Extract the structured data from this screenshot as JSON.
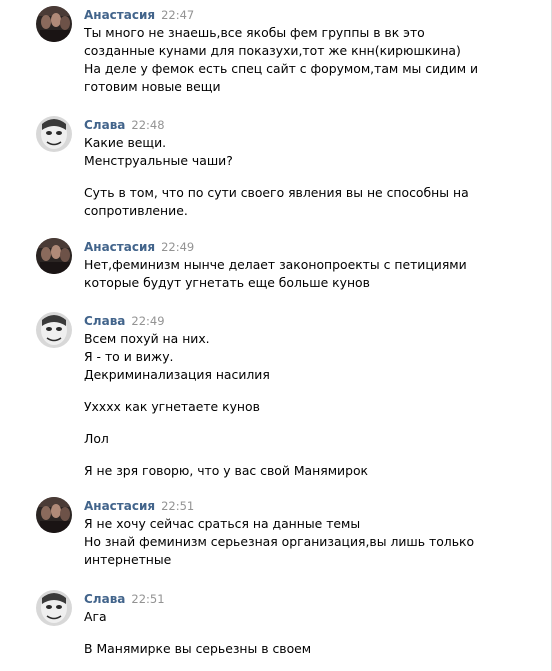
{
  "messages": [
    {
      "author": "Анастасия",
      "time": "22:47",
      "avatar": "anastasia-avatar",
      "lines": [
        "Ты много не знаешь,все якобы фем группы в вк это",
        "созданные кунами для показухи,тот же кнн(кирюшкина)",
        "На деле у фемок есть спец сайт с форумом,там мы сидим и",
        "готовим новые вещи"
      ]
    },
    {
      "author": "Слава",
      "time": "22:48",
      "avatar": "slava-avatar",
      "lines": [
        "Какие вещи.",
        "Менструальные чаши?",
        "",
        "Суть в том, что по сути своего явления вы не способны на",
        "сопротивление."
      ]
    },
    {
      "author": "Анастасия",
      "time": "22:49",
      "avatar": "anastasia-avatar",
      "lines": [
        "Нет,феминизм нынче делает законопроекты с петициями",
        "которые будут угнетать еще больше кунов"
      ]
    },
    {
      "author": "Слава",
      "time": "22:49",
      "avatar": "slava-avatar",
      "lines": [
        "Всем похуй на них.",
        "Я - то и вижу.",
        "Декриминализация насилия",
        "",
        "Ухххх как угнетаете кунов",
        "",
        "Лол",
        "",
        "Я не зря говорю, что у вас свой Манямирок"
      ]
    },
    {
      "author": "Анастасия",
      "time": "22:51",
      "avatar": "anastasia-avatar",
      "lines": [
        "Я не хочу сейчас сраться на данные темы",
        "Но знай феминизм серьезная организация,вы лишь только",
        "интернетные"
      ]
    },
    {
      "author": "Слава",
      "time": "22:51",
      "avatar": "slava-avatar",
      "lines": [
        "Ага",
        "",
        "В Манямирке вы серьезны в своем"
      ]
    }
  ],
  "colors": {
    "author": "#42648b",
    "time": "#939393",
    "text": "#000000",
    "background": "#ffffff"
  }
}
